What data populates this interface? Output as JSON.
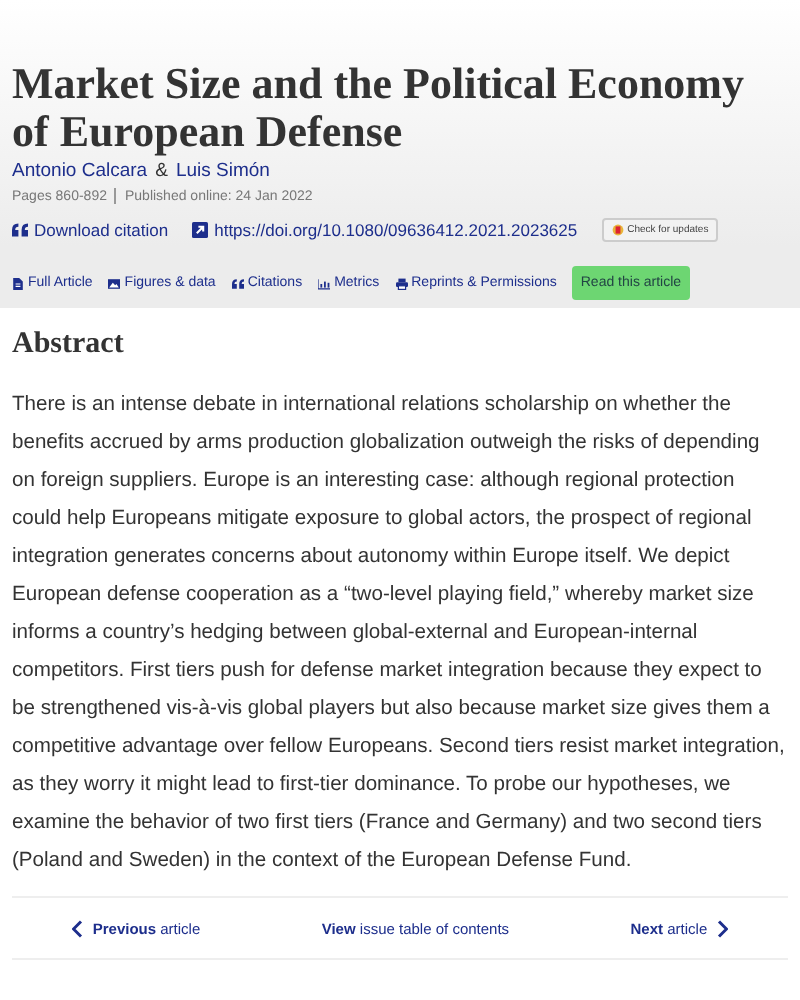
{
  "article": {
    "title": "Market Size and the Political Economy of European Defense",
    "authors": [
      "Antonio Calcara",
      "Luis Simón"
    ],
    "author_separator": "&",
    "pages": "Pages 860-892",
    "published": "Published online: 24 Jan 2022",
    "download_citation": "Download citation",
    "doi": "https://doi.org/10.1080/09636412.2021.2023625",
    "check_updates": "Check for updates"
  },
  "tabs": [
    {
      "label": "Full Article",
      "kind": "doc"
    },
    {
      "label": "Figures & data",
      "kind": "image"
    },
    {
      "label": "Citations",
      "kind": "quote"
    },
    {
      "label": "Metrics",
      "kind": "chart"
    },
    {
      "label": "Reprints & Permissions",
      "kind": "print"
    }
  ],
  "read_button": "Read this article",
  "abstract": {
    "heading": "Abstract",
    "text": "There is an intense debate in international relations scholarship on whether the benefits accrued by arms production globalization outweigh the risks of depending on foreign suppliers. Europe is an interesting case: although regional protection could help Europeans mitigate exposure to global actors, the prospect of regional integration generates concerns about autonomy within Europe itself. We depict European defense cooperation as a “two-level playing field,” whereby market size informs a country’s hedging between global-external and European-internal competitors. First tiers push for defense market integration because they expect to be strengthened vis-à-vis global players but also because market size gives them a competitive advantage over fellow Europeans. Second tiers resist market integration, as they worry it might lead to first-tier dominance. To probe our hypotheses, we examine the behavior of two first tiers (France and Germany) and two second tiers (Poland and Sweden) in the context of the European Defense Fund."
  },
  "navigation": {
    "previous": "**Previous** article",
    "toc": "**View** issue table of contents",
    "next": "**Next** article"
  }
}
